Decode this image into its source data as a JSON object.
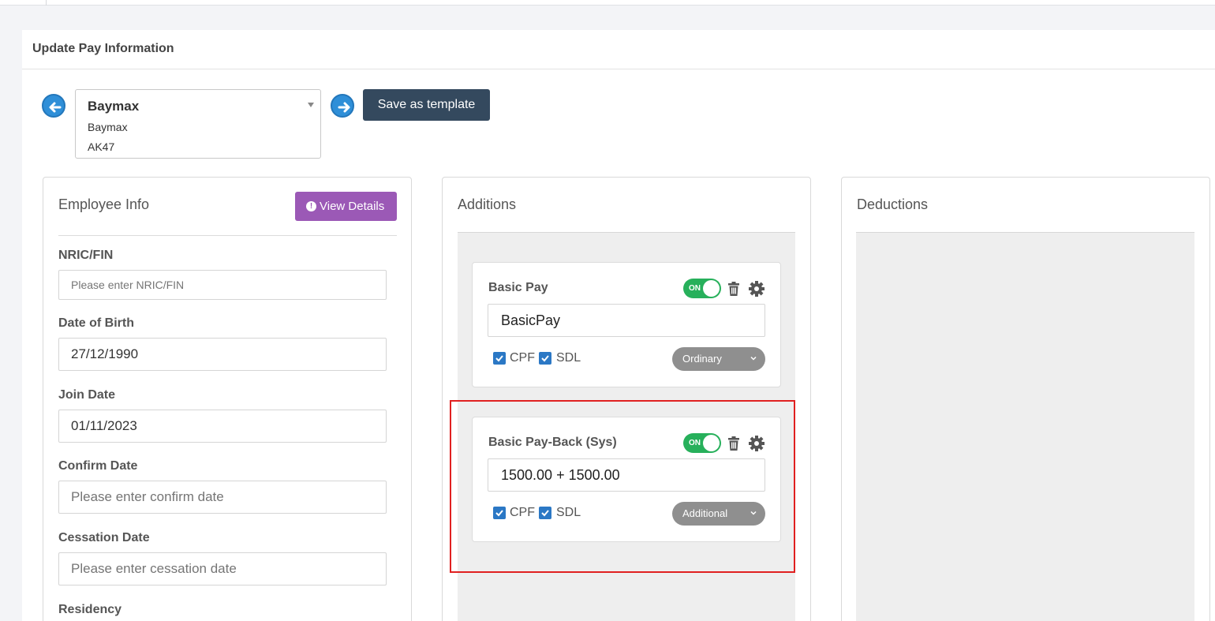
{
  "page": {
    "title": "Update Pay Information"
  },
  "selector": {
    "employee_name": "Baymax",
    "line2": "Baymax",
    "line3": "AK47",
    "save_template_label": "Save as template"
  },
  "employee_info": {
    "title": "Employee Info",
    "view_details_label": "View Details",
    "fields": [
      {
        "label": "NRIC/FIN",
        "value": "",
        "placeholder": "Please enter NRIC/FIN"
      },
      {
        "label": "Date of Birth",
        "value": "27/12/1990",
        "placeholder": ""
      },
      {
        "label": "Join Date",
        "value": "01/11/2023",
        "placeholder": ""
      },
      {
        "label": "Confirm Date",
        "value": "",
        "placeholder": "Please enter confirm date"
      },
      {
        "label": "Cessation Date",
        "value": "",
        "placeholder": "Please enter cessation date"
      },
      {
        "label": "Residency"
      }
    ]
  },
  "additions": {
    "title": "Additions",
    "items": [
      {
        "name": "Basic Pay",
        "toggle": "ON",
        "value": "BasicPay",
        "cpf_label": "CPF",
        "sdl_label": "SDL",
        "cpf": true,
        "sdl": true,
        "type": "Ordinary"
      },
      {
        "name": "Basic Pay-Back (Sys)",
        "toggle": "ON",
        "value": "1500.00 + 1500.00",
        "cpf_label": "CPF",
        "sdl_label": "SDL",
        "cpf": true,
        "sdl": true,
        "type": "Additional"
      }
    ]
  },
  "deductions": {
    "title": "Deductions"
  },
  "colors": {
    "primary_dark": "#34495e",
    "purple": "#9b59b6",
    "toggle_on": "#27b05b",
    "arrow_blue": "#2f8fd8",
    "highlight": "#e02020"
  },
  "icons": [
    "arrow-left-icon",
    "arrow-right-icon",
    "exclamation-circle-icon",
    "trash-icon",
    "gear-icon",
    "check-icon",
    "chevron-down-icon",
    "caret-down-icon"
  ]
}
